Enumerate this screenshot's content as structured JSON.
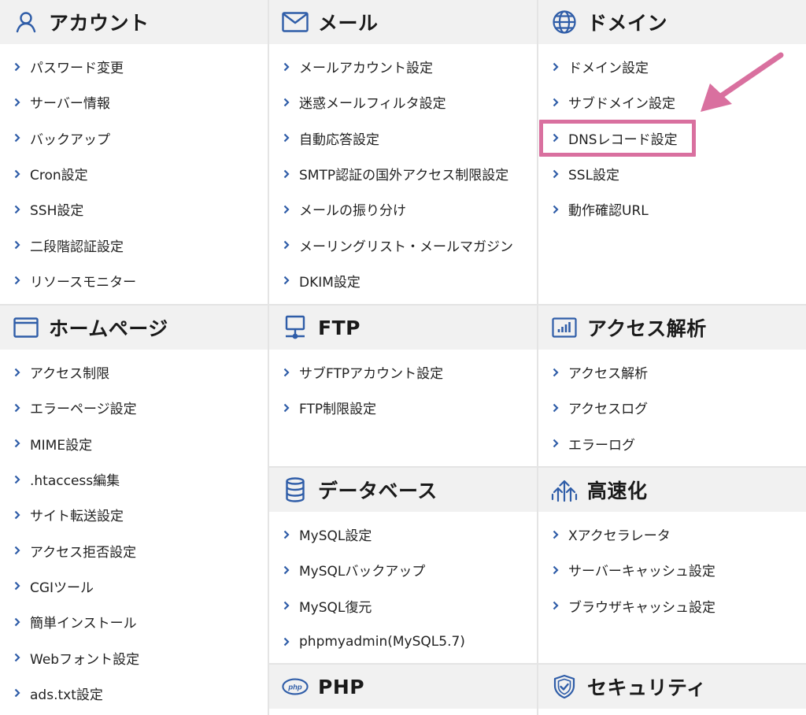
{
  "colors": {
    "accent": "#2f5da8",
    "header_bg": "#f1f1f1",
    "highlight": "#d9709f",
    "chevron": "#2f5da8"
  },
  "columns": [
    {
      "sections": [
        {
          "title": "アカウント",
          "icon": "user-icon",
          "items": [
            "パスワード変更",
            "サーバー情報",
            "バックアップ",
            "Cron設定",
            "SSH設定",
            "二段階認証設定",
            "リソースモニター"
          ]
        },
        {
          "title": "ホームページ",
          "icon": "browser-window-icon",
          "items": [
            "アクセス制限",
            "エラーページ設定",
            "MIME設定",
            ".htaccess編集",
            "サイト転送設定",
            "アクセス拒否設定",
            "CGIツール",
            "簡単インストール",
            "Webフォント設定",
            "ads.txt設定"
          ]
        }
      ]
    },
    {
      "sections": [
        {
          "title": "メール",
          "icon": "envelope-icon",
          "items": [
            "メールアカウント設定",
            "迷惑メールフィルタ設定",
            "自動応答設定",
            "SMTP認証の国外アクセス制限設定",
            "メールの振り分け",
            "メーリングリスト・メールマガジン",
            "DKIM設定"
          ]
        },
        {
          "title": "FTP",
          "icon": "monitor-network-icon",
          "items": [
            "サブFTPアカウント設定",
            "FTP制限設定"
          ]
        },
        {
          "title": "データベース",
          "icon": "database-icon",
          "items": [
            "MySQL設定",
            "MySQLバックアップ",
            "MySQL復元",
            "phpmyadmin(MySQL5.7)"
          ]
        },
        {
          "title": "PHP",
          "icon": "php-icon",
          "items": []
        }
      ]
    },
    {
      "sections": [
        {
          "title": "ドメイン",
          "icon": "globe-icon",
          "items": [
            "ドメイン設定",
            "サブドメイン設定",
            "DNSレコード設定",
            "SSL設定",
            "動作確認URL"
          ]
        },
        {
          "title": "アクセス解析",
          "icon": "bar-chart-icon",
          "items": [
            "アクセス解析",
            "アクセスログ",
            "エラーログ"
          ]
        },
        {
          "title": "高速化",
          "icon": "speed-arrows-icon",
          "items": [
            "Xアクセラレータ",
            "サーバーキャッシュ設定",
            "ブラウザキャッシュ設定"
          ]
        },
        {
          "title": "セキュリティ",
          "icon": "shield-check-icon",
          "items": []
        }
      ]
    }
  ]
}
